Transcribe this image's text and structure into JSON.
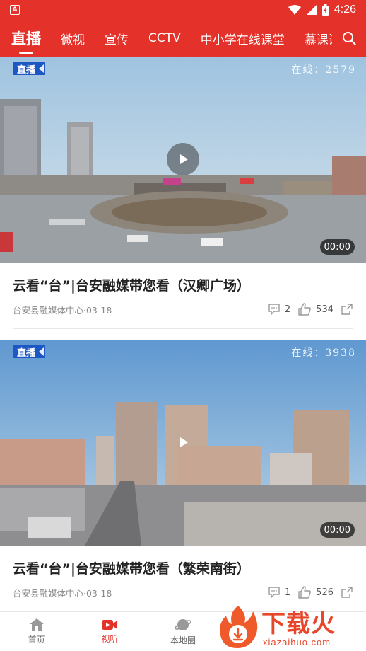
{
  "status_bar": {
    "time": "4:26",
    "app_badge": "A"
  },
  "tabs": [
    {
      "label": "直播",
      "active": true
    },
    {
      "label": "微视",
      "active": false
    },
    {
      "label": "宣传",
      "active": false
    },
    {
      "label": "CCTV",
      "active": false
    },
    {
      "label": "中小学在线课堂",
      "active": false
    },
    {
      "label": "慕课讲堂",
      "active": false
    }
  ],
  "feed": [
    {
      "badge": "直播",
      "online": "在线：2579",
      "duration": "00:00",
      "title": "云看“台”|台安融媒带您看（汉卿广场）",
      "source": "台安县融媒体中心·03-18",
      "comments": "2",
      "likes": "534"
    },
    {
      "badge": "直播",
      "online": "在线：3938",
      "duration": "00:00",
      "title": "云看“台”|台安融媒带您看（繁荣南街）",
      "source": "台安县融媒体中心·03-18",
      "comments": "1",
      "likes": "526"
    }
  ],
  "bottom_nav": [
    {
      "label": "首页",
      "icon": "home-icon",
      "active": false
    },
    {
      "label": "视听",
      "icon": "video-icon",
      "active": true
    },
    {
      "label": "本地圈",
      "icon": "planet-icon",
      "active": false
    }
  ],
  "watermark": {
    "text": "下载火",
    "sub": "xiazaihuo.com"
  },
  "colors": {
    "brand_red": "#e4322a",
    "live_blue": "#1d57c4"
  }
}
